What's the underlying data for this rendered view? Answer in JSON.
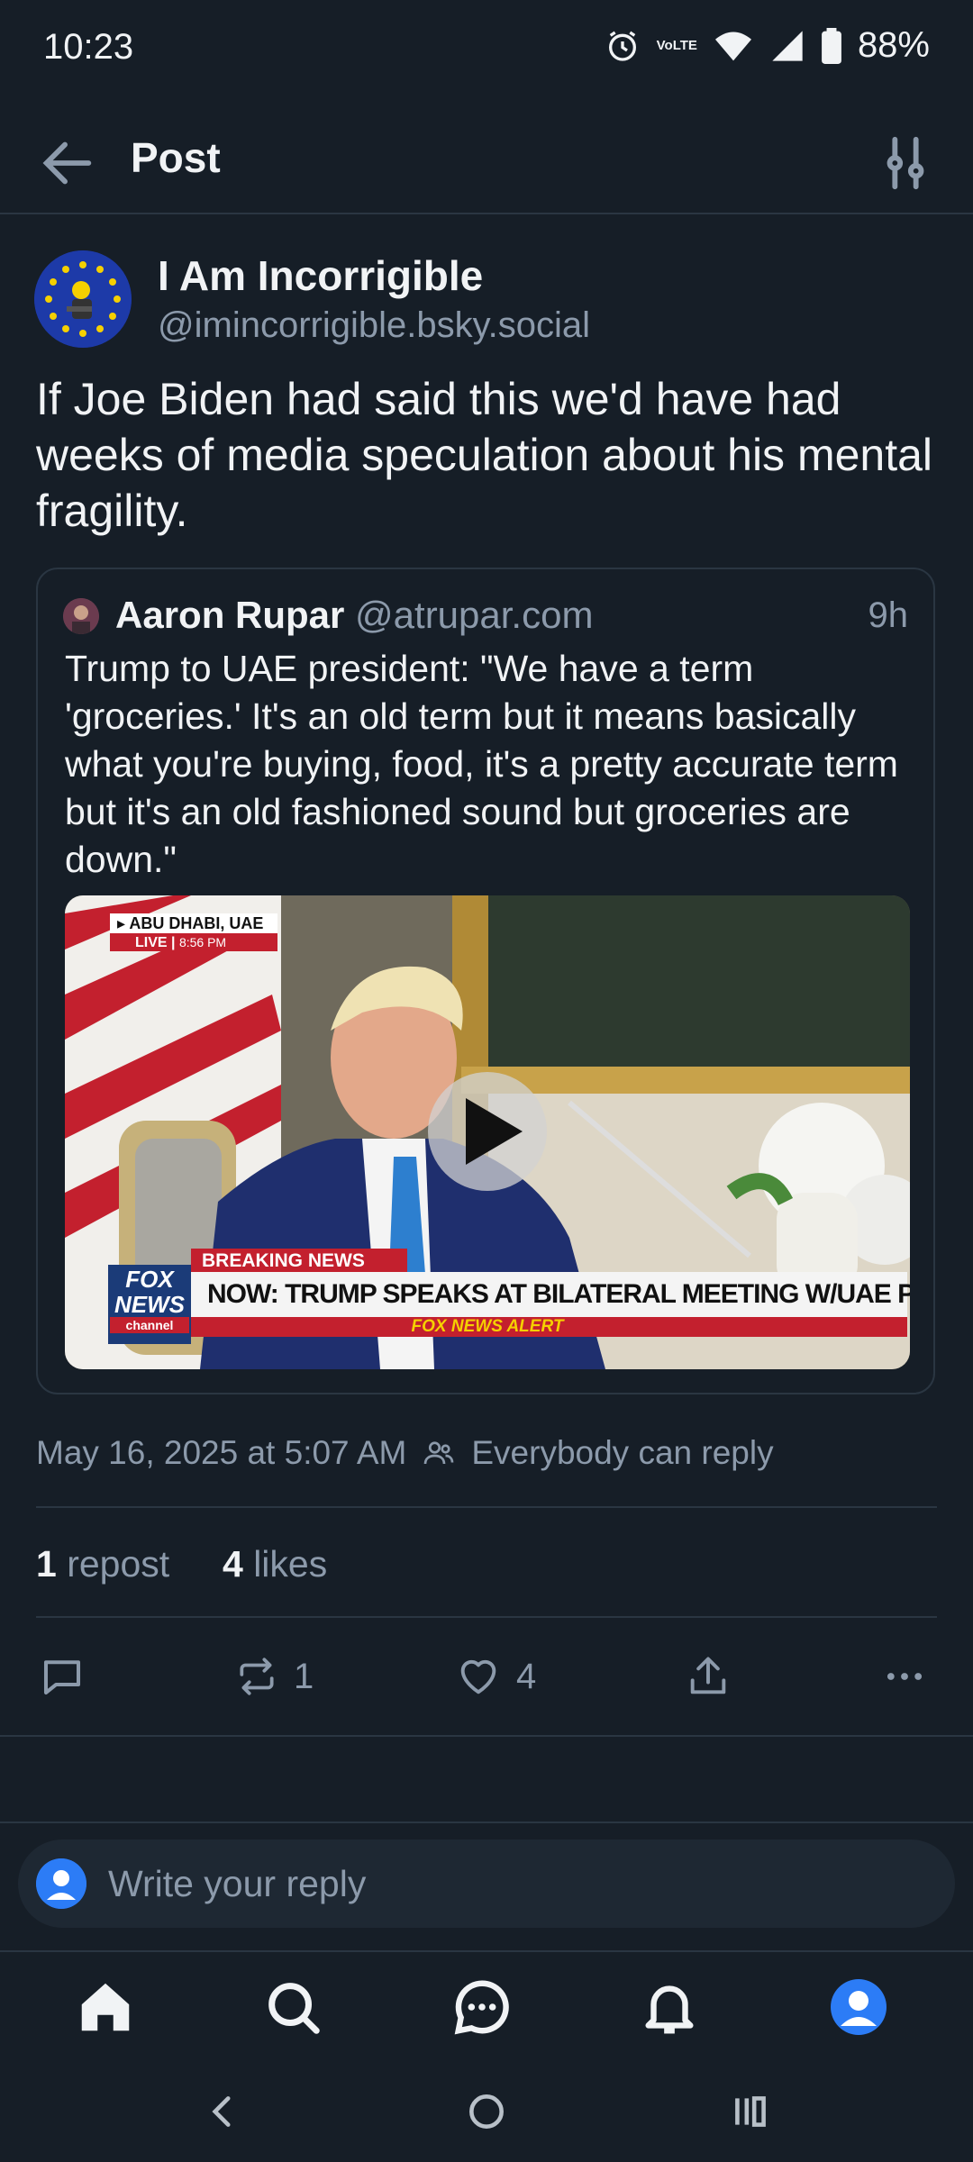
{
  "status_bar": {
    "time": "10:23",
    "battery": "88%",
    "network_label": "VoLTE"
  },
  "header": {
    "title": "Post",
    "back_icon": "arrow-left-icon",
    "filter_icon": "sliders-icon"
  },
  "post": {
    "author_name": "I Am Incorrigible",
    "author_handle": "@imincorrigible.bsky.social",
    "text": "If Joe Biden had said this we'd have had weeks of media speculation about his mental fragility.",
    "quote": {
      "author_name": "Aaron Rupar",
      "author_handle": "@atrupar.com",
      "time_ago": "9h",
      "text": "Trump to UAE president: \"We have a term 'groceries.' It's an old term but it means basically what you're buying, food, it's a pretty accurate term but it's an old fashioned sound but groceries are down.\"",
      "video": {
        "location_tag": "ABU DHABI, UAE",
        "live_label": "LIVE",
        "live_time": "8:56 PM",
        "breaking_label": "BREAKING NEWS",
        "headline": "NOW: TRUMP SPEAKS AT BILATERAL MEETING W/UAE PRES",
        "alert_label": "FOX NEWS ALERT",
        "network_logo_lines": [
          "FOX",
          "NEWS",
          "channel"
        ]
      }
    },
    "timestamp": "May 16, 2025 at 5:07 AM",
    "reply_setting": "Everybody can reply",
    "repost_count": "1",
    "repost_label": "repost",
    "like_count": "4",
    "like_label": "likes",
    "actions": {
      "repost_count": "1",
      "like_count": "4"
    }
  },
  "reply_box": {
    "placeholder": "Write your reply"
  },
  "bottom_nav": [
    "home-icon",
    "search-icon",
    "chat-icon",
    "bell-icon",
    "profile-icon"
  ],
  "colors": {
    "background": "#161e27",
    "accent": "#2c7cf6",
    "muted": "#8c9aab",
    "divider": "#2a3642"
  }
}
